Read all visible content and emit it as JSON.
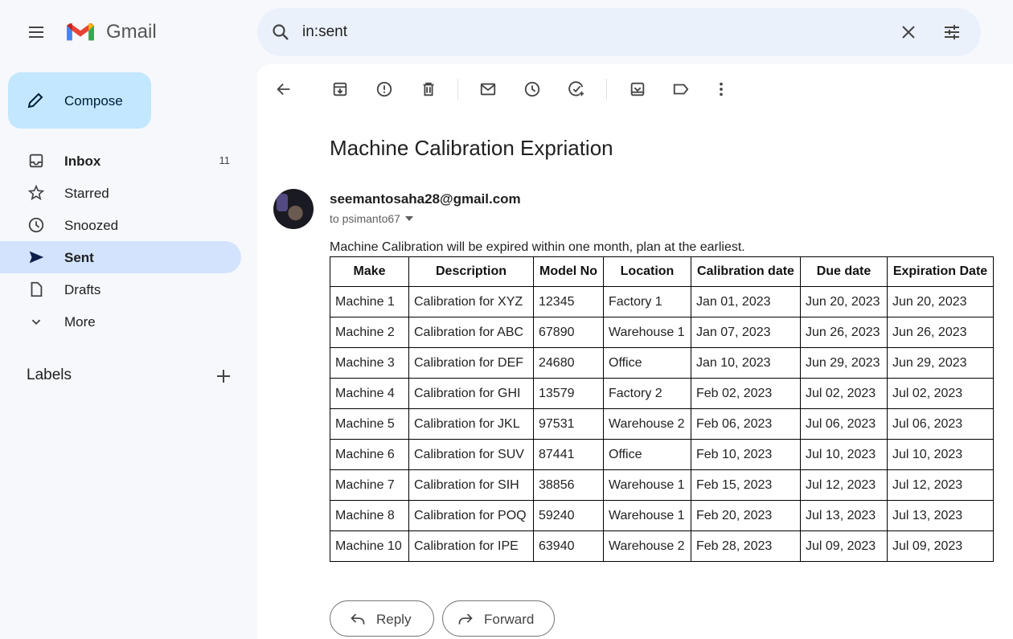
{
  "app": {
    "name": "Gmail"
  },
  "search": {
    "query": "in:sent"
  },
  "compose_label": "Compose",
  "nav": [
    {
      "label": "Inbox",
      "count": "11",
      "icon": "inbox-icon",
      "bold": true
    },
    {
      "label": "Starred",
      "icon": "star-icon"
    },
    {
      "label": "Snoozed",
      "icon": "clock-icon"
    },
    {
      "label": "Sent",
      "icon": "send-icon",
      "active": true
    },
    {
      "label": "Drafts",
      "icon": "draft-icon"
    },
    {
      "label": "More",
      "icon": "chevron-down-icon"
    }
  ],
  "labels_heading": "Labels",
  "email": {
    "subject": "Machine Calibration Expriation",
    "sender": "seemantosaha28@gmail.com",
    "to": "to psimanto67",
    "body": "Machine Calibration will be expired within one month, plan at the earliest.",
    "table": {
      "headers": [
        "Make",
        "Description",
        "Model No",
        "Location",
        "Calibration date",
        "Due date",
        "Expiration Date"
      ],
      "rows": [
        [
          "Machine 1",
          "Calibration for XYZ",
          "12345",
          "Factory 1",
          "Jan 01, 2023",
          "Jun 20, 2023",
          "Jun 20, 2023"
        ],
        [
          "Machine 2",
          "Calibration for ABC",
          "67890",
          "Warehouse 1",
          "Jan 07, 2023",
          "Jun 26, 2023",
          "Jun 26, 2023"
        ],
        [
          "Machine 3",
          "Calibration for DEF",
          "24680",
          "Office",
          "Jan 10, 2023",
          "Jun 29, 2023",
          "Jun 29, 2023"
        ],
        [
          "Machine 4",
          "Calibration for GHI",
          "13579",
          "Factory 2",
          "Feb 02, 2023",
          "Jul 02, 2023",
          "Jul 02, 2023"
        ],
        [
          "Machine 5",
          "Calibration for JKL",
          "97531",
          "Warehouse 2",
          "Feb 06, 2023",
          "Jul 06, 2023",
          "Jul 06, 2023"
        ],
        [
          "Machine 6",
          "Calibration for SUV",
          "87441",
          "Office",
          "Feb 10, 2023",
          "Jul 10, 2023",
          "Jul 10, 2023"
        ],
        [
          "Machine 7",
          "Calibration for SIH",
          "38856",
          "Warehouse 1",
          "Feb 15, 2023",
          "Jul 12, 2023",
          "Jul 12, 2023"
        ],
        [
          "Machine 8",
          "Calibration for POQ",
          "59240",
          "Warehouse 1",
          "Feb 20, 2023",
          "Jul 13, 2023",
          "Jul 13, 2023"
        ],
        [
          "Machine 10",
          "Calibration for IPE",
          "63940",
          "Warehouse 2",
          "Feb 28, 2023",
          "Jul 09, 2023",
          "Jul 09, 2023"
        ]
      ]
    },
    "reply_label": "Reply",
    "forward_label": "Forward"
  },
  "colors": {
    "accent": "#c2e7ff",
    "active_nav": "#d3e3fd",
    "search_bg": "#eaf1fb"
  }
}
